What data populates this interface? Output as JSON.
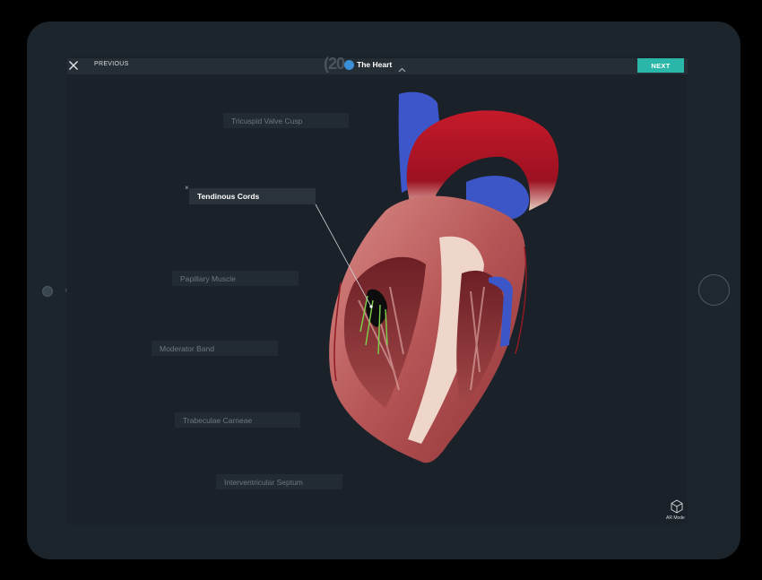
{
  "toolbar": {
    "previous_label": "PREVIOUS",
    "next_label": "NEXT",
    "title": "The Heart",
    "logo_number": "(20"
  },
  "labels": [
    {
      "text": "Tricuspid Valve Cusp"
    },
    {
      "text": "Tendinous Cords"
    },
    {
      "text": "Papillary Muscle"
    },
    {
      "text": "Moderator Band"
    },
    {
      "text": "Trabeculae Carneae"
    },
    {
      "text": "Interventricular Septum"
    }
  ],
  "ar_mode": {
    "label": "AR Mode",
    "icon": "cube-icon"
  },
  "colors": {
    "accent": "#2ab7a9",
    "highlight": "#7cd24a",
    "aorta": "#c0182a",
    "vein": "#3b5fd1"
  }
}
